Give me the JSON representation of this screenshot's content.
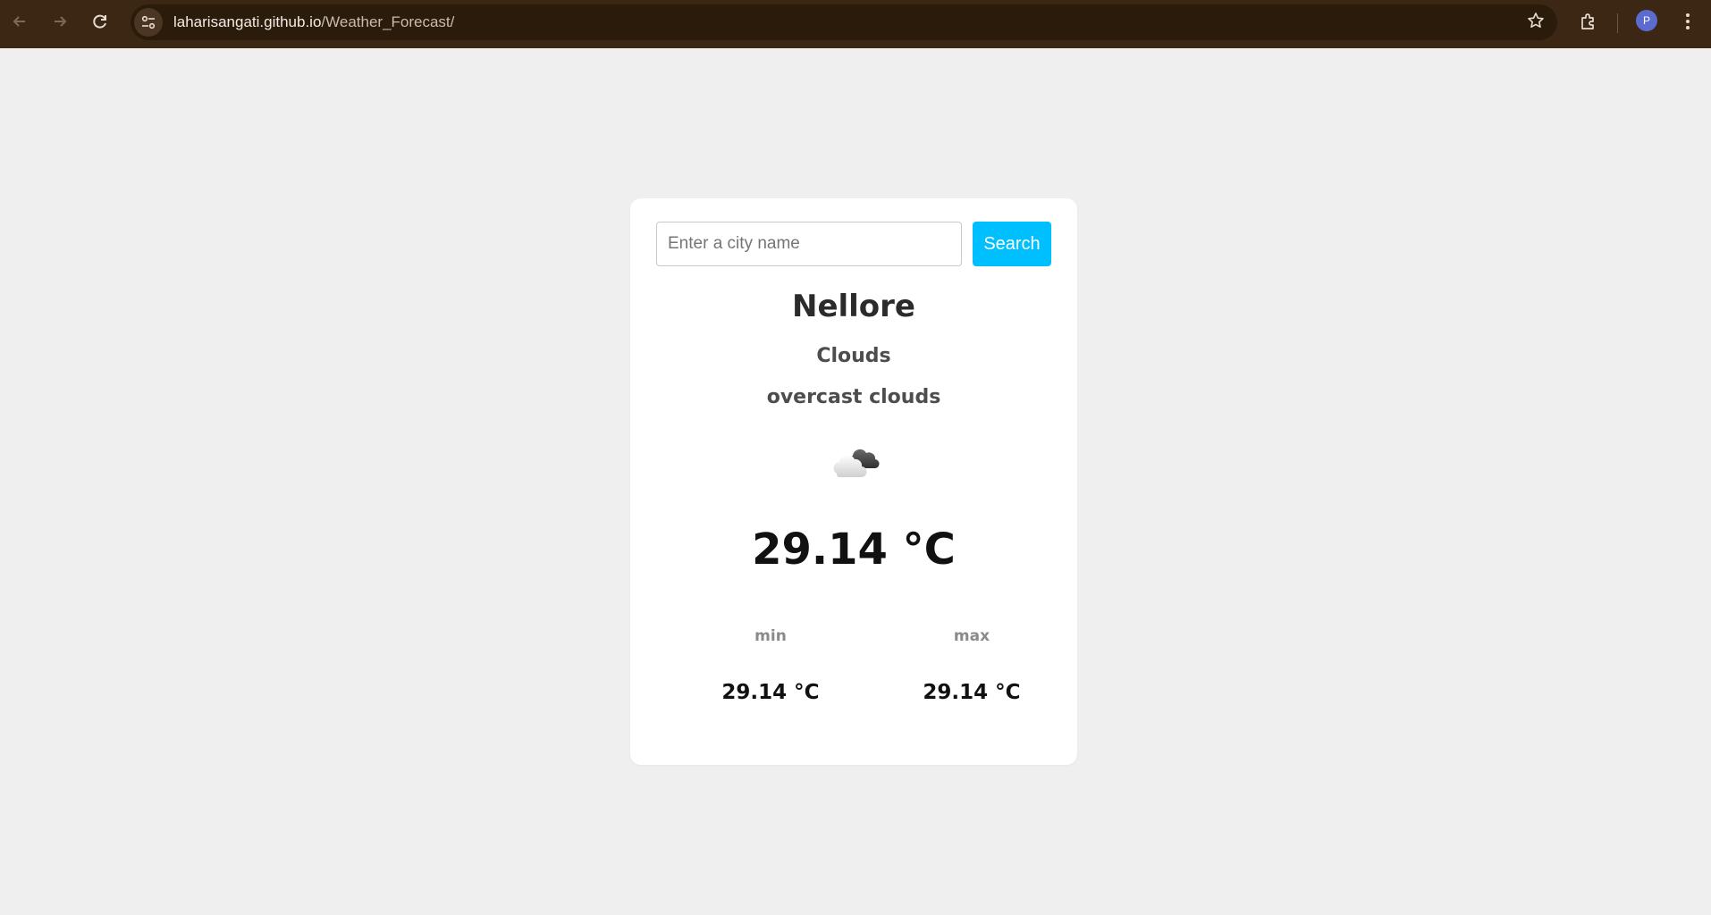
{
  "browser": {
    "url_host": "laharisangati.github.io",
    "url_path": "/Weather_Forecast/",
    "profile_initial": "P"
  },
  "search": {
    "placeholder": "Enter a city name",
    "value": "",
    "button_label": "Search"
  },
  "weather": {
    "city": "Nellore",
    "condition": "Clouds",
    "description": "overcast clouds",
    "icon": "overcast-clouds-icon",
    "temperature": "29.14 °C",
    "min_label": "min",
    "min_value": "29.14 °C",
    "max_label": "max",
    "max_value": "29.14 °C"
  },
  "colors": {
    "chrome": "#3b2713",
    "page_background": "#efefef",
    "search_button": "#00bfff"
  }
}
